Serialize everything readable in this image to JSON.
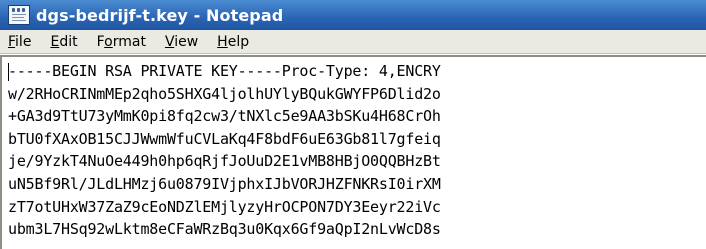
{
  "window": {
    "title": "dgs-bedrijf-t.key - Notepad",
    "app_icon": "notepad-icon"
  },
  "menu": {
    "items": [
      {
        "mnemonic": "F",
        "rest": "ile"
      },
      {
        "mnemonic": "E",
        "rest": "dit"
      },
      {
        "pre": "F",
        "mnemonic": "o",
        "rest": "rmat"
      },
      {
        "mnemonic": "V",
        "rest": "iew"
      },
      {
        "mnemonic": "H",
        "rest": "elp"
      }
    ]
  },
  "editor": {
    "lines": [
      "-----BEGIN RSA PRIVATE KEY-----Proc-Type: 4,ENCRY",
      "w/2RHoCRINmMEp2qho5SHXG4ljolhUYlyBQukGWYFP6Dlid2o",
      "+GA3d9TtU73yMmK0pi8fq2cw3/tNXlc5e9AA3bSKu4H68CrOh",
      "bTU0fXAxOB15CJJWwmWfuCVLaKq4F8bdF6uE63Gb81l7gfeiq",
      "je/9YzkT4NuOe449h0hp6qRjfJoUuD2E1vMB8HBjO0QQBHzBt",
      "uN5Bf9Rl/JLdLHMzj6u0879IVjphxIJbVORJHZFNKRsI0irXM",
      "zT7otUHxW37ZaZ9cEoNDZlEMjlyzyHrOCPON7DY3Eeyr22iVc",
      "ubm3L7HSq92wLktm8eCFaWRzBq3u0Kqx6Gf9aQpI2nLvWcD8s"
    ]
  }
}
